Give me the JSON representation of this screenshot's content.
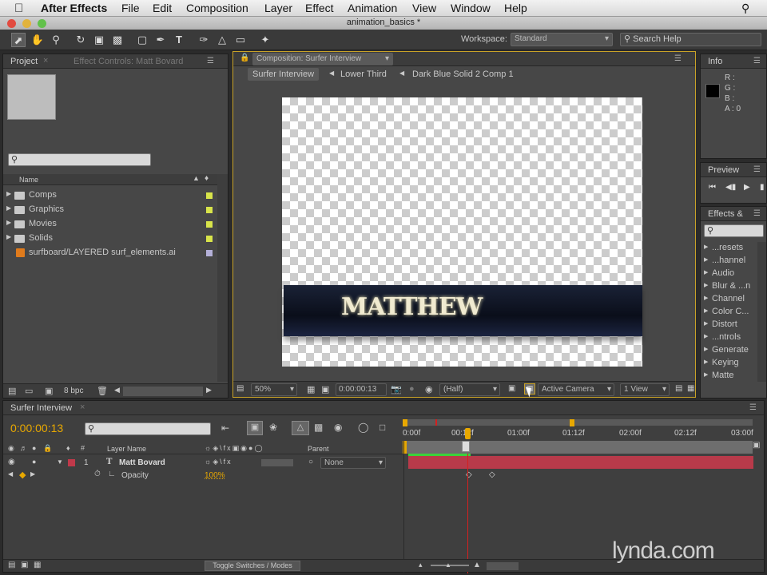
{
  "menubar": {
    "apple": "",
    "app": "After Effects",
    "items": [
      "File",
      "Edit",
      "Composition",
      "Layer",
      "Effect",
      "Animation",
      "View",
      "Window",
      "Help"
    ]
  },
  "window_title": "animation_basics *",
  "toolbar": {
    "workspace_label": "Workspace:",
    "workspace_value": "Standard",
    "search_help_placeholder": "Search Help"
  },
  "project_panel": {
    "tab_project": "Project",
    "tab_effect_controls": "Effect Controls: Matt Bovard",
    "col_name": "Name",
    "items": [
      {
        "label": "Comps",
        "type": "folder",
        "color": "#d8e44a"
      },
      {
        "label": "Graphics",
        "type": "folder",
        "color": "#d8e44a"
      },
      {
        "label": "Movies",
        "type": "folder",
        "color": "#d8e44a"
      },
      {
        "label": "Solids",
        "type": "folder",
        "color": "#d8e44a"
      },
      {
        "label": "surfboard/LAYERED surf_elements.ai",
        "type": "ai",
        "color": "#b4b0d8"
      }
    ],
    "bpc": "8 bpc"
  },
  "composition_panel": {
    "tab": "Composition: Surfer Interview",
    "breadcrumbs": [
      "Surfer Interview",
      "Lower Third",
      "Dark Blue Solid 2 Comp 1"
    ],
    "lower_third_text": "MATTHEW",
    "zoom": "50%",
    "timecode": "0:00:00:13",
    "resolution": "(Half)",
    "camera": "Active Camera",
    "views": "1 View"
  },
  "info_panel": {
    "tab": "Info",
    "r": "R :",
    "g": "G :",
    "b": "B :",
    "a": "A : 0"
  },
  "preview_panel": {
    "tab": "Preview"
  },
  "effects_panel": {
    "tab": "Effects &",
    "items": [
      "...resets",
      "...hannel",
      "Audio",
      "Blur & ...n",
      "Channel",
      "Color C...",
      "Distort",
      "...ntrols",
      "Generate",
      "Keying",
      "Matte"
    ]
  },
  "timeline": {
    "tab": "Surfer Interview",
    "timecode": "0:00:00:13",
    "col_layer_name": "Layer Name",
    "col_parent": "Parent",
    "ruler": [
      "0:00f",
      "00:12f",
      "01:00f",
      "01:12f",
      "02:00f",
      "02:12f",
      "03:00f"
    ],
    "layer": {
      "number": "1",
      "name": "Matt Bovard",
      "parent": "None",
      "label_color": "#c0394a"
    },
    "property": {
      "name": "Opacity",
      "value": "100%"
    },
    "toggle_label": "Toggle Switches / Modes"
  },
  "watermark": "lynda.com",
  "colors": {
    "accent_time": "#e8a800",
    "playhead": "#d42020",
    "layer_bar": "#b83a4a",
    "panel_focus": "#c9a227"
  }
}
